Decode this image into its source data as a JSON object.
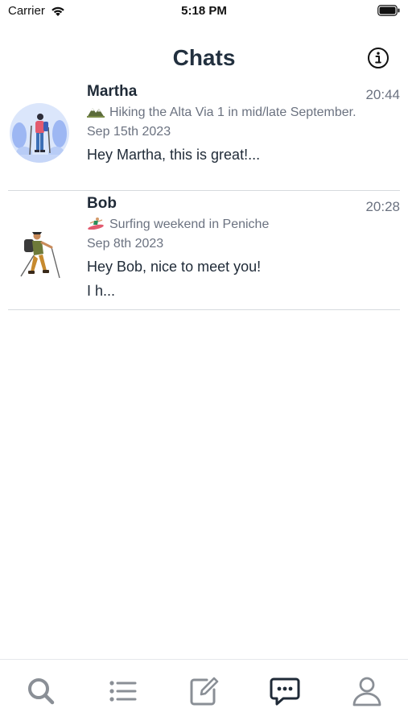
{
  "status_bar": {
    "carrier": "Carrier",
    "time": "5:18 PM"
  },
  "header": {
    "title": "Chats",
    "info_icon": "info-circle-icon"
  },
  "chats": [
    {
      "name": "Martha",
      "time": "20:44",
      "trip_emoji": "mountain-icon",
      "trip_title": "Hiking the Alta Via 1 in mid/late September.",
      "trip_date": "Sep 15th 2023",
      "preview": "Hey Martha, this is great!..."
    },
    {
      "name": "Bob",
      "time": "20:28",
      "trip_emoji": "surfer-icon",
      "trip_title": "Surfing weekend in Peniche",
      "trip_date": "Sep 8th 2023",
      "preview": "Hey Bob, nice to meet you!",
      "preview_line2": "I h..."
    }
  ],
  "tab_bar": {
    "active_tab": "chats",
    "icons": [
      "search-icon",
      "list-icon",
      "compose-icon",
      "chat-bubble-icon",
      "profile-icon"
    ]
  },
  "colors": {
    "title": "#22303f",
    "secondary_text": "#6b7280",
    "divider": "#d6dade",
    "tab_inactive": "#8a8f96",
    "tab_active": "#1f2a37"
  }
}
